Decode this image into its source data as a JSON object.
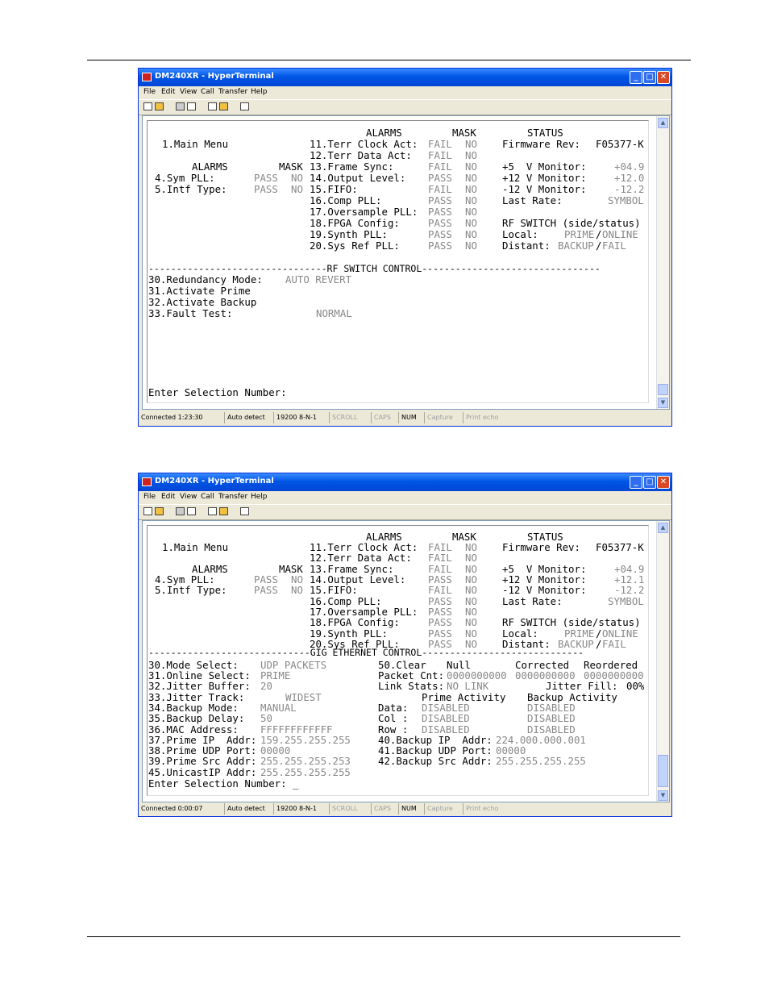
{
  "windows": [
    {
      "title": "DM240XR - HyperTerminal",
      "menu": [
        "File",
        "Edit",
        "View",
        "Call",
        "Transfer",
        "Help"
      ],
      "status": [
        "Connected 1:23:30",
        "Auto detect",
        "19200 8-N-1",
        "SCROLL",
        "CAPS",
        "NUM",
        "Capture",
        "Print echo"
      ],
      "terminal": {
        "col1": {
          "main_menu": "1.Main Menu",
          "alarms_hdr": "ALARMS",
          "mask_hdr": "MASK",
          "row4_label": "4.Sym PLL:",
          "row4_alarm": "PASS",
          "row4_mask": "NO",
          "row5_label": "5.Intf Type:",
          "row5_alarm": "PASS",
          "row5_mask": "NO"
        },
        "col2": {
          "alarms_hdr": "ALARMS",
          "mask_hdr": "MASK",
          "rows": [
            {
              "label": "11.Terr Clock Act:",
              "alarm": "FAIL",
              "mask": "NO"
            },
            {
              "label": "12.Terr Data Act:",
              "alarm": "FAIL",
              "mask": "NO"
            },
            {
              "label": "13.Frame Sync:",
              "alarm": "FAIL",
              "mask": "NO"
            },
            {
              "label": "14.Output Level:",
              "alarm": "PASS",
              "mask": "NO"
            },
            {
              "label": "15.FIFO:",
              "alarm": "FAIL",
              "mask": "NO"
            },
            {
              "label": "16.Comp PLL:",
              "alarm": "PASS",
              "mask": "NO"
            },
            {
              "label": "17.Oversample PLL:",
              "alarm": "PASS",
              "mask": "NO"
            },
            {
              "label": "18.FPGA Config:",
              "alarm": "PASS",
              "mask": "NO"
            },
            {
              "label": "19.Synth PLL:",
              "alarm": "PASS",
              "mask": "NO"
            },
            {
              "label": "20.Sys Ref PLL:",
              "alarm": "PASS",
              "mask": "NO"
            }
          ]
        },
        "col3": {
          "status_hdr": "STATUS",
          "fw_label": "Firmware Rev:",
          "fw_value": "F05377-K",
          "p5_label": "+5  V Monitor:",
          "p5_value": "+04.9",
          "p12_label": "+12 V Monitor:",
          "p12_value": "+12.0",
          "m12_label": "-12 V Monitor:",
          "m12_value": "-12.2",
          "rate_label": "Last Rate:",
          "rate_value": "SYMBOL",
          "rf_hdr": "RF SWITCH (side/status)",
          "local_label": "Local:",
          "local_side": "PRIME",
          "local_status": "ONLINE",
          "distant_label": "Distant:",
          "distant_side": "BACKUP",
          "distant_status": "FAIL"
        },
        "divider": "--------------------------------RF SWITCH CONTROL--------------------------------",
        "rf": {
          "r30_label": "30.Redundancy Mode:",
          "r30_value": "AUTO REVERT",
          "r31": "31.Activate Prime",
          "r32": "32.Activate Backup",
          "r33_label": "33.Fault Test:",
          "r33_value": "NORMAL"
        },
        "prompt": "Enter Selection Number:"
      }
    },
    {
      "title": "DM240XR - HyperTerminal",
      "menu": [
        "File",
        "Edit",
        "View",
        "Call",
        "Transfer",
        "Help"
      ],
      "status": [
        "Connected 0:00:07",
        "Auto detect",
        "19200 8-N-1",
        "SCROLL",
        "CAPS",
        "NUM",
        "Capture",
        "Print echo"
      ],
      "terminal": {
        "col1": {
          "main_menu": "1.Main Menu",
          "alarms_hdr": "ALARMS",
          "mask_hdr": "MASK",
          "row4_label": "4.Sym PLL:",
          "row4_alarm": "PASS",
          "row4_mask": "NO",
          "row5_label": "5.Intf Type:",
          "row5_alarm": "PASS",
          "row5_mask": "NO"
        },
        "col2": {
          "alarms_hdr": "ALARMS",
          "mask_hdr": "MASK",
          "rows": [
            {
              "label": "11.Terr Clock Act:",
              "alarm": "FAIL",
              "mask": "NO"
            },
            {
              "label": "12.Terr Data Act:",
              "alarm": "FAIL",
              "mask": "NO"
            },
            {
              "label": "13.Frame Sync:",
              "alarm": "FAIL",
              "mask": "NO"
            },
            {
              "label": "14.Output Level:",
              "alarm": "PASS",
              "mask": "NO"
            },
            {
              "label": "15.FIFO:",
              "alarm": "FAIL",
              "mask": "NO"
            },
            {
              "label": "16.Comp PLL:",
              "alarm": "PASS",
              "mask": "NO"
            },
            {
              "label": "17.Oversample PLL:",
              "alarm": "PASS",
              "mask": "NO"
            },
            {
              "label": "18.FPGA Config:",
              "alarm": "PASS",
              "mask": "NO"
            },
            {
              "label": "19.Synth PLL:",
              "alarm": "PASS",
              "mask": "NO"
            },
            {
              "label": "20.Sys Ref PLL:",
              "alarm": "PASS",
              "mask": "NO"
            }
          ]
        },
        "col3": {
          "status_hdr": "STATUS",
          "fw_label": "Firmware Rev:",
          "fw_value": "F05377-K",
          "p5_label": "+5  V Monitor:",
          "p5_value": "+04.9",
          "p12_label": "+12 V Monitor:",
          "p12_value": "+12.1",
          "m12_label": "-12 V Monitor:",
          "m12_value": "-12.2",
          "rate_label": "Last Rate:",
          "rate_value": "SYMBOL",
          "rf_hdr": "RF SWITCH (side/status)",
          "local_label": "Local:",
          "local_side": "PRIME",
          "local_status": "ONLINE",
          "distant_label": "Distant:",
          "distant_side": "BACKUP",
          "distant_status": "FAIL"
        },
        "divider": "-----------------------------GIG ETHERNET CONTROL-----------------------------",
        "gig": {
          "r30_label": "30.Mode Select:",
          "r30_value": "UDP PACKETS",
          "r31_label": "31.Online Select:",
          "r31_value": "PRIME",
          "r32_label": "32.Jitter Buffer:",
          "r32_value": "20",
          "r33_label": "33.Jitter Track:",
          "r33_value": "WIDEST",
          "r34_label": "34.Backup Mode:",
          "r34_value": "MANUAL",
          "r35_label": "35.Backup Delay:",
          "r35_value": "50",
          "r36_label": "36.MAC Address:",
          "r36_value": "FFFFFFFFFFFF",
          "r37_label": "37.Prime IP  Addr:",
          "r37_value": "159.255.255.255",
          "r38_label": "38.Prime UDP Port:",
          "r38_value": "00000",
          "r39_label": "39.Prime Src Addr:",
          "r39_value": "255.255.255.253",
          "r45_label": "45.UnicastIP Addr:",
          "r45_value": "255.255.255.255",
          "r50_label": "50.Clear",
          "r50_value": "Null",
          "corrected_hdr": "Corrected",
          "reordered_hdr": "Reordered",
          "pkt_label": "Packet Cnt:",
          "pkt_value": "0000000000",
          "corr_value": "0000000000",
          "reord_value": "0000000000",
          "link_label": "Link Stats:",
          "link_value": "NO LINK",
          "jfill_label": "Jitter Fill:",
          "jfill_value": "00%",
          "prime_act_hdr": "Prime Activity",
          "backup_act_hdr": "Backup Activity",
          "data_label": "Data:",
          "data_prime": "DISABLED",
          "data_backup": "DISABLED",
          "col_label": "Col :",
          "col_prime": "DISABLED",
          "col_backup": "DISABLED",
          "row_label": "Row :",
          "row_prime": "DISABLED",
          "row_backup": "DISABLED",
          "r40_label": "40.Backup IP  Addr:",
          "r40_value": "224.000.000.001",
          "r41_label": "41.Backup UDP Port:",
          "r41_value": "00000",
          "r42_label": "42.Backup Src Addr:",
          "r42_value": "255.255.255.255"
        },
        "prompt": "Enter Selection Number: _"
      }
    }
  ]
}
